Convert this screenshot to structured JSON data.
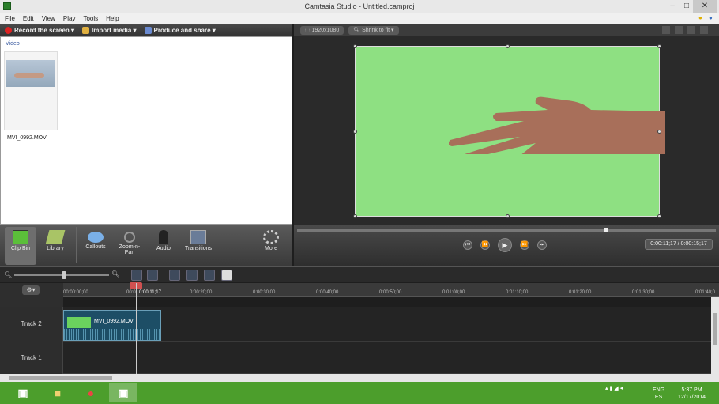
{
  "window": {
    "title": "Camtasia Studio - Untitled.camproj",
    "minimize": "–",
    "maximize": "□",
    "close": "✕"
  },
  "menu": [
    "File",
    "Edit",
    "View",
    "Play",
    "Tools",
    "Help"
  ],
  "toolbar": {
    "record": "Record the screen ▾",
    "import": "Import media ▾",
    "produce": "Produce and share ▾"
  },
  "clipbin": {
    "section": "Video",
    "clip_name": "MVI_0992.MOV"
  },
  "tabs": [
    "Clip Bin",
    "Library",
    "Callouts",
    "Zoom-n-Pan",
    "Audio",
    "Transitions",
    "More"
  ],
  "preview": {
    "resolution": "1920x1080",
    "zoom": "Shrink to fit"
  },
  "player": {
    "timecode": "0:00:11;17 / 0:00:15;17"
  },
  "timeline": {
    "ticks": [
      "00:00:00;00",
      "00:0",
      "0:00:11;17",
      "0:00:20;00",
      "0:00:30;00",
      "0:00:40;00",
      "0:00:50;00",
      "0:01:00;00",
      "0:01:10;00",
      "0:01:20;00",
      "0:01:30;00",
      "0:01:40;0"
    ],
    "tracks": [
      "Track 2",
      "Track 1"
    ],
    "clip_label": "MVI_0992.MOV"
  },
  "taskbar": {
    "lang": "ENG",
    "region": "ES",
    "time": "5:37 PM",
    "date": "12/17/2014"
  },
  "colors": {
    "greenscreen": "#8ee082",
    "taskbar": "#4c9e2c",
    "clip": "#1d4e66"
  }
}
